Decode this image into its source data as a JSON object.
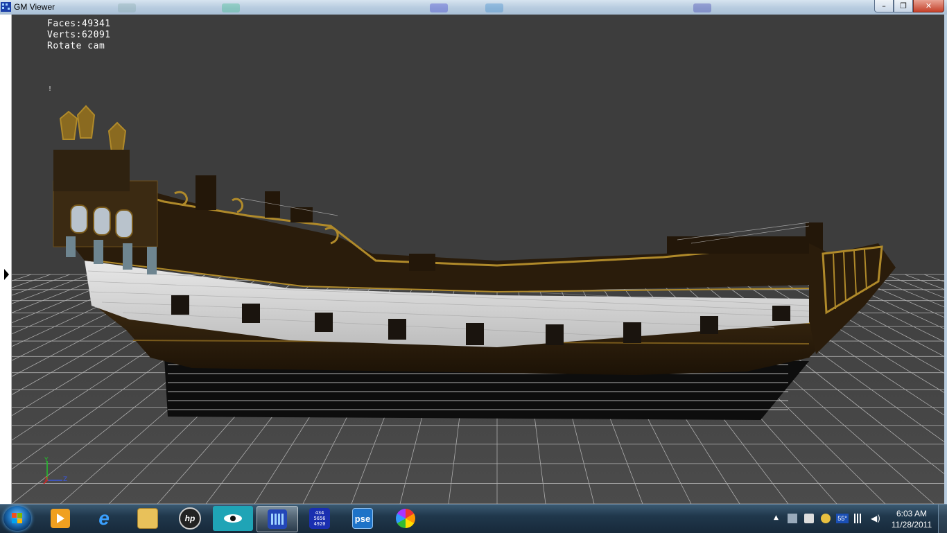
{
  "window": {
    "title": "GM Viewer",
    "controls": {
      "minimize": "–",
      "maximize": "❐",
      "close": "✕"
    }
  },
  "viewport": {
    "stats": {
      "faces": "Faces:49341",
      "verts": "Verts:62091",
      "mode": "Rotate cam"
    },
    "marker": "!",
    "axis_labels": {
      "y": "Y",
      "x": "X",
      "z": "Z"
    },
    "model": "three-masted galleon hull (no masts) on grid floor"
  },
  "taskbar": {
    "items": [
      {
        "name": "media-player-icon",
        "label": ""
      },
      {
        "name": "internet-explorer-icon",
        "label": "e"
      },
      {
        "name": "file-explorer-icon",
        "label": ""
      },
      {
        "name": "hp-icon",
        "label": "hp"
      },
      {
        "name": "eye-app-icon",
        "label": ""
      },
      {
        "name": "gm-viewer-icon",
        "label": ""
      },
      {
        "name": "calculator-app-icon",
        "label": "434\n5656\n4920"
      },
      {
        "name": "pse-icon",
        "label": "pse"
      },
      {
        "name": "picasa-icon",
        "label": ""
      }
    ],
    "tray": {
      "temperature": "55°",
      "time": "6:03 AM",
      "date": "11/28/2011"
    }
  },
  "colors": {
    "taskbar": "#1c3347",
    "viewport_bg": "#3d3d3d",
    "grid_line": "#ffffff",
    "hull_dark": "#2b1d0c",
    "hull_white": "#dcdcdc",
    "gold_trim": "#b08a2a"
  }
}
